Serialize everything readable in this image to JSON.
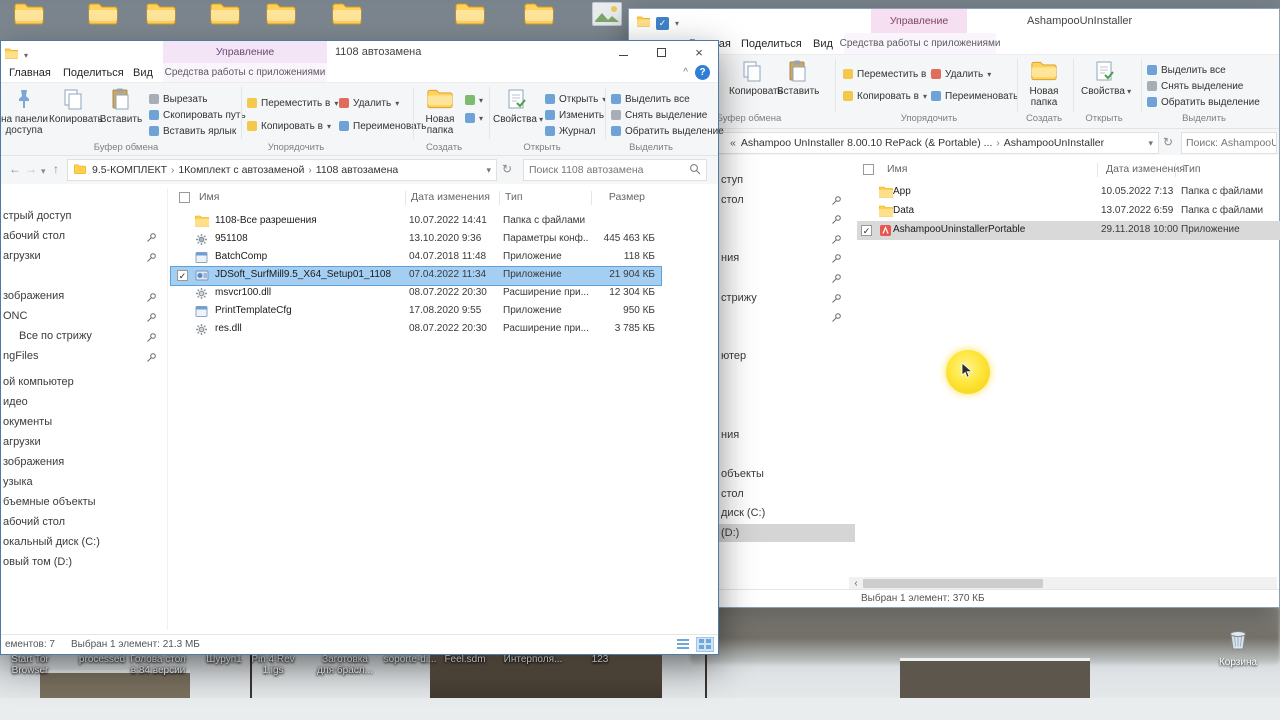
{
  "colors": {
    "contextual_header_front": "#f3e4f6",
    "contextual_header_back": "#f6dff0",
    "selection_blue": "#a5cff2",
    "selection_gray": "#d9d9d9",
    "cursor_highlight": "#ffe63c"
  },
  "desktop": {
    "top_icons": [
      "folder",
      "folder",
      "folder",
      "folder",
      "folder",
      "folder",
      "folder",
      "folder",
      "image"
    ],
    "bottom_labels": [
      {
        "lines": [
          "Start Tor",
          "Browser"
        ]
      },
      {
        "lines": [
          "processed"
        ]
      },
      {
        "lines": [
          "Голова стол",
          "в 84 версии"
        ]
      },
      {
        "lines": [
          "Шуруп1"
        ]
      },
      {
        "lines": [
          "Pin 4 Rev",
          "1.igs"
        ]
      },
      {
        "lines": [
          "Заготовка",
          "для брасл..."
        ]
      },
      {
        "lines": [
          "soporte-di..."
        ]
      },
      {
        "lines": [
          "Feel.sdm"
        ]
      },
      {
        "lines": [
          "Интерполя..."
        ]
      },
      {
        "lines": [
          "123"
        ]
      }
    ],
    "recycle_bin_label": "Корзина"
  },
  "front_window": {
    "titlebar": {
      "contextual_header": "Управление",
      "title": "1108 автозамена"
    },
    "tabs": {
      "home": "Главная",
      "share": "Поделиться",
      "view": "Вид",
      "contextual": "Средства работы с приложениями"
    },
    "ribbon": {
      "pin_clipped_line1": "на панели",
      "pin_clipped_line2": "доступа",
      "copy": "Копировать",
      "paste": "Вставить",
      "cut": "Вырезать",
      "copy_path": "Скопировать путь",
      "paste_shortcut": "Вставить ярлык",
      "move_to": "Переместить в",
      "copy_to": "Копировать в",
      "delete": "Удалить",
      "rename": "Переименовать",
      "new_folder_line1": "Новая",
      "new_folder_line2": "папка",
      "properties": "Свойства",
      "open": "Открыть",
      "edit": "Изменить",
      "history": "Журнал",
      "select_all": "Выделить все",
      "select_none": "Снять выделение",
      "invert_selection": "Обратить выделение",
      "group_clipboard": "Буфер обмена",
      "group_organize": "Упорядочить",
      "group_new": "Создать",
      "group_open": "Открыть",
      "group_select": "Выделить"
    },
    "address": {
      "crumb1": "9.5-КОМПЛЕКТ",
      "crumb2": "1Комплект с автозаменой",
      "crumb3": "1108 автозамена",
      "search_placeholder": "Поиск 1108 автозамена"
    },
    "sidebar": {
      "quick_access": [
        {
          "label": "стрый доступ"
        },
        {
          "label": "абочий стол",
          "pin": true
        },
        {
          "label": "агрузки",
          "pin": true
        },
        {
          "label": ""
        },
        {
          "label": "зображения",
          "pin": true
        },
        {
          "label": "ONC",
          "pin": true
        },
        {
          "label": "Все по стрижу",
          "pin": true,
          "indent": true
        },
        {
          "label": "ngFiles",
          "pin": true
        }
      ],
      "this_pc": [
        {
          "label": "ой компьютер"
        },
        {
          "label": "идео"
        },
        {
          "label": "окументы"
        },
        {
          "label": "агрузки"
        },
        {
          "label": "зображения"
        },
        {
          "label": "узыка"
        },
        {
          "label": "бъемные объекты"
        },
        {
          "label": "абочий стол"
        },
        {
          "label": "окальный диск (C:)"
        },
        {
          "label": "овый том (D:)"
        }
      ]
    },
    "columns": {
      "name": "Имя",
      "date": "Дата изменения",
      "type": "Тип",
      "size": "Размер"
    },
    "files": [
      {
        "icon": "folder",
        "name": "1108-Все разрешения",
        "date": "10.07.2022 14:41",
        "type": "Папка с файлами",
        "size": ""
      },
      {
        "icon": "config",
        "name": "951108",
        "date": "13.10.2020 9:36",
        "type": "Параметры конф...",
        "size": "445 463 КБ"
      },
      {
        "icon": "app",
        "name": "BatchComp",
        "date": "04.07.2018 11:48",
        "type": "Приложение",
        "size": "118 КБ"
      },
      {
        "icon": "setup",
        "name": "JDSoft_SurfMill9.5_X64_Setup01_1108",
        "date": "07.04.2022 11:34",
        "type": "Приложение",
        "size": "21 904 КБ",
        "selected": true,
        "checked": true
      },
      {
        "icon": "dll",
        "name": "msvcr100.dll",
        "date": "08.07.2022 20:30",
        "type": "Расширение при...",
        "size": "12 304 КБ"
      },
      {
        "icon": "app",
        "name": "PrintTemplateCfg",
        "date": "17.08.2020 9:55",
        "type": "Приложение",
        "size": "950 КБ"
      },
      {
        "icon": "dll",
        "name": "res.dll",
        "date": "08.07.2022 20:30",
        "type": "Расширение при...",
        "size": "3 785 КБ"
      }
    ],
    "statusbar": {
      "count": "ементов: 7",
      "selection": "Выбран 1 элемент: 21.3 МБ"
    }
  },
  "back_window": {
    "titlebar": {
      "contextual_header": "Управление",
      "title": "AshampooUnInstaller"
    },
    "tabs": {
      "home": "Главная",
      "share": "Поделиться",
      "view": "Вид",
      "contextual": "Средства работы с приложениями"
    },
    "ribbon": {
      "copy": "Копировать",
      "paste": "Вставить",
      "move_to": "Переместить в",
      "copy_to": "Копировать в",
      "delete": "Удалить",
      "rename": "Переименовать",
      "new_folder_line1": "Новая",
      "new_folder_line2": "папка",
      "properties": "Свойства",
      "select_all": "Выделить все",
      "select_none": "Снять выделение",
      "invert_selection": "Обратить выделение",
      "group_clipboard": "Буфер обмена",
      "group_organize": "Упорядочить",
      "group_new": "Создать",
      "group_open": "Открыть",
      "group_select": "Выделить"
    },
    "address": {
      "overflow": "«",
      "path": "Ashampoo UnInstaller 8.00.10 RePack (& Portable) ...",
      "crumb": "AshampooUnInstaller",
      "search_placeholder": "Поиск: AshampooUnInsta"
    },
    "sidebar_fragments": [
      {
        "row": 0,
        "label": "ступ"
      },
      {
        "row": 1,
        "label": "стол",
        "pin": true
      },
      {
        "row": 2,
        "label": "",
        "pin": true
      },
      {
        "row": 3,
        "label": "",
        "pin": true
      },
      {
        "row": 4,
        "label": "ния",
        "pin": true
      },
      {
        "row": 5,
        "label": "",
        "pin": true
      },
      {
        "row": 6,
        "label": "стрижу",
        "pin": true
      },
      {
        "row": 7,
        "label": "",
        "pin": true
      },
      {
        "row": 9,
        "label": "ютер"
      },
      {
        "row": 13,
        "label": "ния"
      },
      {
        "row": 15,
        "label": "объекты"
      },
      {
        "row": 16,
        "label": "стол"
      },
      {
        "row": 17,
        "label": "диск (C:)"
      },
      {
        "row": 18,
        "label": "(D:)",
        "selected": true
      }
    ],
    "columns": {
      "name": "Имя",
      "date": "Дата изменения",
      "type": "Тип"
    },
    "files": [
      {
        "icon": "folder",
        "name": "App",
        "date": "10.05.2022 7:13",
        "type": "Папка с файлами"
      },
      {
        "icon": "folder",
        "name": "Data",
        "date": "13.07.2022 6:59",
        "type": "Папка с файлами"
      },
      {
        "icon": "app-red",
        "name": "AshampooUninstallerPortable",
        "date": "29.11.2018 10:00",
        "type": "Приложение",
        "selected": true,
        "checked": true
      }
    ],
    "statusbar": {
      "selection": "Выбран 1 элемент: 370 КБ"
    }
  }
}
